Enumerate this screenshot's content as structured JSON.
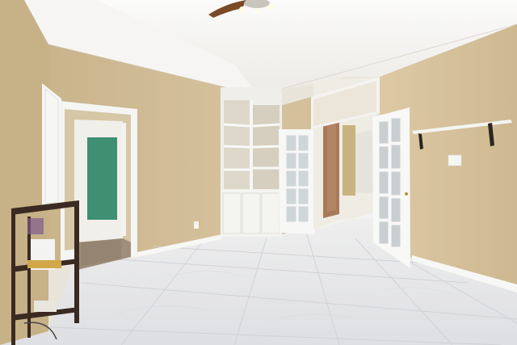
{
  "scene": {
    "kind": "photograph",
    "subject": "empty-room-interior",
    "colors": {
      "wall": "#d7c39d",
      "wall_shadow": "#c7b28a",
      "ceiling": "#f2f1ef",
      "floor": "#e7e7ea",
      "trim": "#f7f7f5",
      "hall_green": "#3f8f73",
      "shelf_dark": "#3b2a22",
      "column_brick": "#a97a5a"
    }
  }
}
